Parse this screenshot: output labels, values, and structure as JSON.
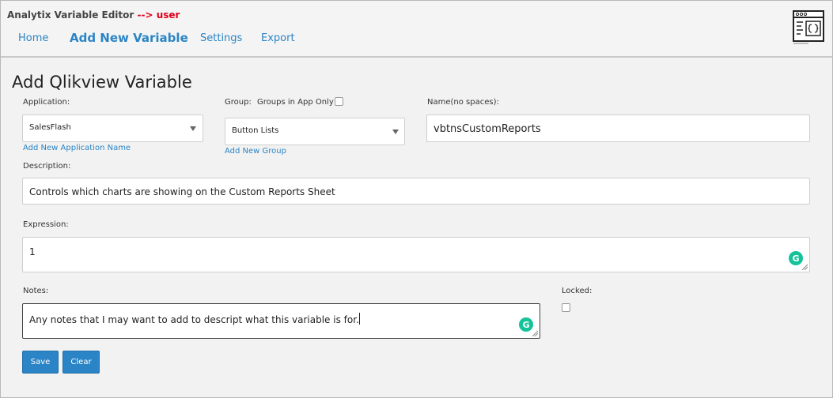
{
  "header": {
    "app_title": "Analytix Variable Editor",
    "app_arrow": "-->",
    "app_user": "user",
    "nav": [
      "Home",
      "Add New Variable",
      "Settings",
      "Export"
    ],
    "active_nav": "Add New Variable",
    "logo_icon": "code-window-icon"
  },
  "form": {
    "title": "Add Qlikview Variable",
    "application": {
      "label": "Application:",
      "value": "SalesFlash",
      "link": "Add New Application Name"
    },
    "group": {
      "label": "Group:",
      "groups_in_app_label": "Groups in App Only",
      "groups_in_app_checked": false,
      "value": "Button Lists",
      "link": "Add New Group"
    },
    "name": {
      "label": "Name(no spaces):",
      "value": "vbtnsCustomReports"
    },
    "description": {
      "label": "Description:",
      "value": "Controls which charts are showing on the Custom Reports Sheet"
    },
    "expression": {
      "label": "Expression:",
      "value": "1"
    },
    "notes": {
      "label": "Notes:",
      "value": "Any notes that I may want to add to descript what this variable is for."
    },
    "locked": {
      "label": "Locked:",
      "checked": false
    },
    "buttons": {
      "save": "Save",
      "clear": "Clear"
    }
  },
  "colors": {
    "accent": "#2a84c5",
    "user": "#e0001b",
    "grammarly": "#15c39a"
  }
}
